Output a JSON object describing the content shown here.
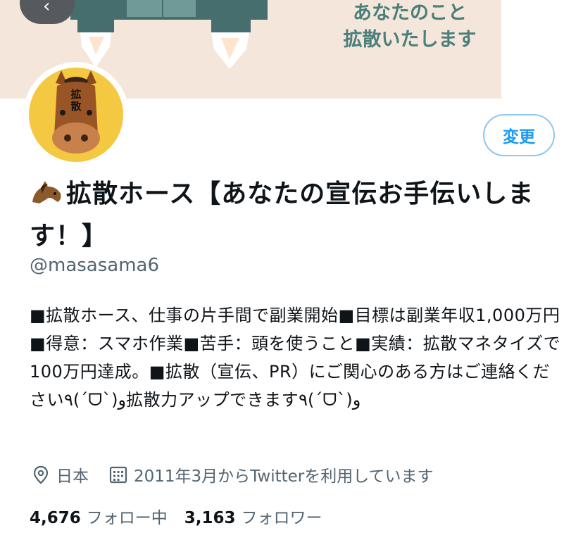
{
  "banner": {
    "line1": "あなたのこと",
    "line2": "拡散いたします"
  },
  "header": {
    "back_icon": "chevron-left-icon"
  },
  "profile": {
    "avatar_icon": "horse-avatar",
    "avatar_text": "拡散",
    "edit_label": "変更",
    "name_emoji": "horse-icon",
    "name": "拡散ホース【あなたの宣伝お手伝いします！】",
    "handle": "@masasama6",
    "bio": "■拡散ホース、仕事の片手間で副業開始■目標は副業年収1,000万円■得意：スマホ作業■苦手：頭を使うこと■実績：拡散マネタイズで100万円達成。■拡散（宣伝、PR）にご関心のある方はご連絡ください٩(ˊᗜˋ)و拡散力アップできます٩(ˊᗜˋ)و",
    "location": "日本",
    "location_icon": "location-pin-icon",
    "joined": "2011年3月からTwitterを利用しています",
    "joined_icon": "calendar-icon",
    "following_count": "4,676",
    "following_label": "フォロー中",
    "followers_count": "3,163",
    "followers_label": "フォロワー"
  },
  "colors": {
    "accent": "#1d9bf0",
    "banner_bg": "#f4e6db",
    "banner_teal": "#4a7f7a",
    "muted": "#536471"
  }
}
